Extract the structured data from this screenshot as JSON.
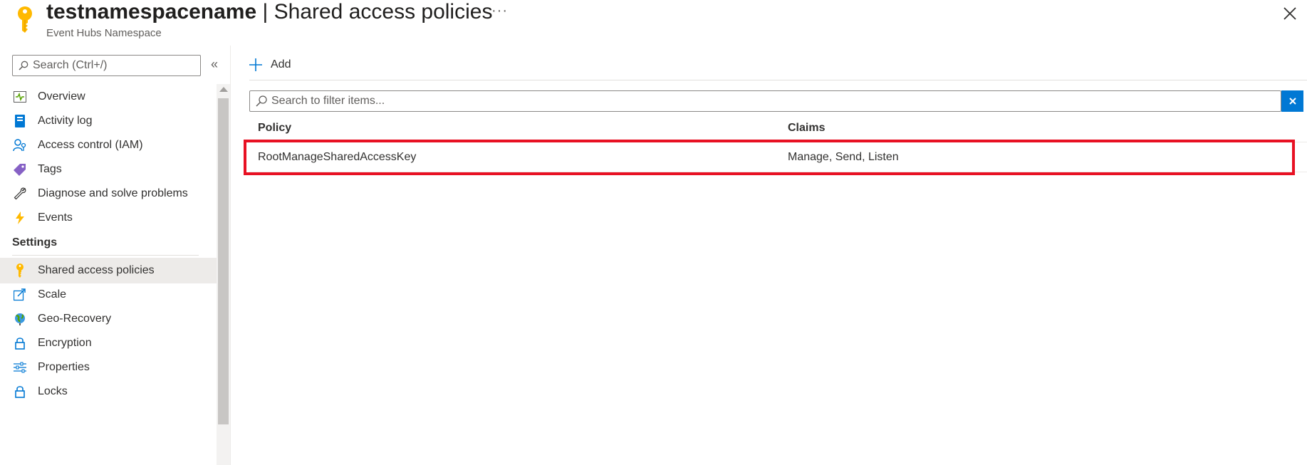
{
  "header": {
    "resource_name": "testnamespacename",
    "separator": " | ",
    "page_title": "Shared access policies",
    "subtitle": "Event Hubs Namespace",
    "more_label": "···"
  },
  "sidebar": {
    "search_placeholder": "Search (Ctrl+/)",
    "collapse_label": "«",
    "items_top": [
      {
        "label": "Overview",
        "icon": "overview-icon"
      },
      {
        "label": "Activity log",
        "icon": "activity-log-icon"
      },
      {
        "label": "Access control (IAM)",
        "icon": "iam-icon"
      },
      {
        "label": "Tags",
        "icon": "tag-icon"
      },
      {
        "label": "Diagnose and solve problems",
        "icon": "wrench-icon"
      },
      {
        "label": "Events",
        "icon": "lightning-icon"
      }
    ],
    "section_settings": "Settings",
    "items_settings": [
      {
        "label": "Shared access policies",
        "icon": "key-icon",
        "selected": true
      },
      {
        "label": "Scale",
        "icon": "scale-edit-icon"
      },
      {
        "label": "Geo-Recovery",
        "icon": "globe-icon"
      },
      {
        "label": "Encryption",
        "icon": "lock-icon"
      },
      {
        "label": "Properties",
        "icon": "sliders-icon"
      },
      {
        "label": "Locks",
        "icon": "lock-icon"
      }
    ]
  },
  "toolbar": {
    "add_label": "Add"
  },
  "filter": {
    "placeholder": "Search to filter items..."
  },
  "table": {
    "columns": [
      "Policy",
      "Claims"
    ],
    "rows": [
      {
        "policy": "RootManageSharedAccessKey",
        "claims": "Manage, Send, Listen"
      }
    ]
  },
  "colors": {
    "accent": "#0078d4",
    "highlight": "#e81123",
    "key_yellow": "#ffb900"
  }
}
